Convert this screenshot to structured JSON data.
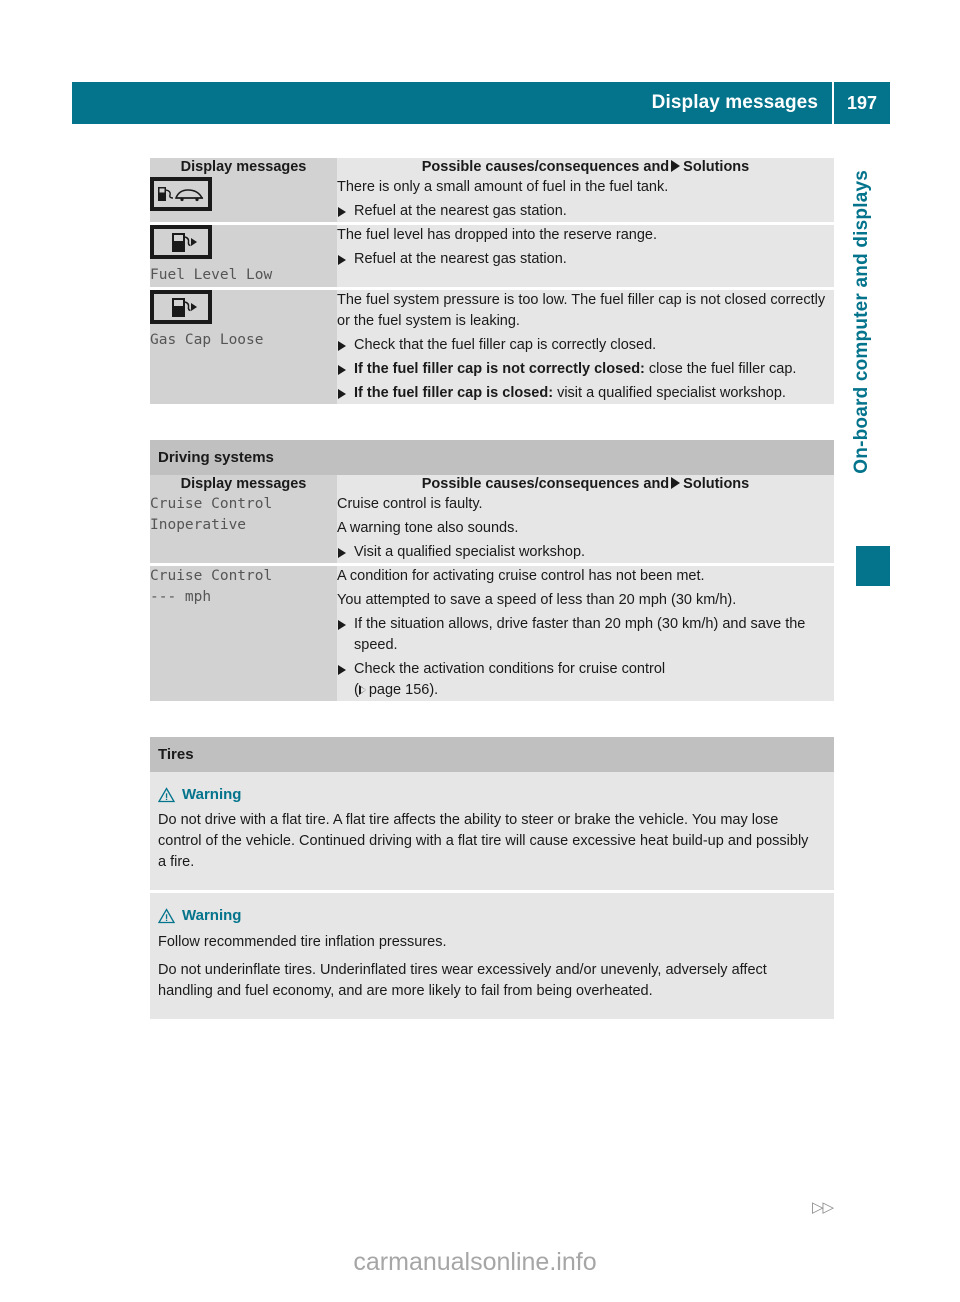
{
  "header": {
    "title": "Display messages",
    "page_number": "197"
  },
  "sidebar": {
    "chapter_label": "On-board computer and displays"
  },
  "table_fuel": {
    "col1_header": "Display messages",
    "col2_header_pre": "Possible causes/consequences and",
    "col2_header_post": "Solutions",
    "rows": [
      {
        "icon": "fuel-pump-car-icon",
        "message_code": "",
        "lines": [
          {
            "type": "para",
            "text": "There is only a small amount of fuel in the fuel tank."
          },
          {
            "type": "bullet",
            "text": "Refuel at the nearest gas station."
          }
        ]
      },
      {
        "icon": "fuel-pump-arrow-icon",
        "message_code": "Fuel Level Low",
        "lines": [
          {
            "type": "para",
            "text": "The fuel level has dropped into the reserve range."
          },
          {
            "type": "bullet",
            "text": "Refuel at the nearest gas station."
          }
        ]
      },
      {
        "icon": "fuel-pump-arrow-icon",
        "message_code": "Gas Cap Loose",
        "lines": [
          {
            "type": "para",
            "text": "The fuel system pressure is too low. The fuel filler cap is not closed correctly or the fuel system is leaking."
          },
          {
            "type": "bullet",
            "text": "Check that the fuel filler cap is correctly closed."
          },
          {
            "type": "bullet",
            "bold": "If the fuel filler cap is not correctly closed:",
            "text": "close the fuel filler cap."
          },
          {
            "type": "bullet",
            "bold": "If the fuel filler cap is closed:",
            "text": "visit a qualified specialist workshop."
          }
        ]
      }
    ]
  },
  "section_driving": {
    "band_title": "Driving systems",
    "col1_header": "Display messages",
    "col2_header_pre": "Possible causes/consequences and",
    "col2_header_post": "Solutions",
    "rows": [
      {
        "message_code": "Cruise Control\nInoperative",
        "lines": [
          {
            "type": "para",
            "text": "Cruise control is faulty."
          },
          {
            "type": "para",
            "text": "A warning tone also sounds."
          },
          {
            "type": "bullet",
            "text": "Visit a qualified specialist workshop."
          }
        ]
      },
      {
        "message_code": "Cruise Control\n--- mph",
        "lines": [
          {
            "type": "para",
            "text": "A condition for activating cruise control has not been met."
          },
          {
            "type": "para",
            "text": "You attempted to save a speed of less than 20 mph (30 km/h)."
          },
          {
            "type": "bullet",
            "text": "If the situation allows, drive faster than 20 mph (30 km/h) and save the speed."
          },
          {
            "type": "bullet-ref",
            "text": "Check the activation conditions for cruise control",
            "ref_open": "(",
            "ref_text": "page 156",
            "ref_close": ")."
          }
        ]
      }
    ]
  },
  "section_tires": {
    "band_title": "Tires",
    "warnings": [
      {
        "title": "Warning",
        "body": "Do not drive with a flat tire. A flat tire affects the ability to steer or brake the vehicle. You may lose control of the vehicle. Continued driving with a flat tire will cause excessive heat build-up and possibly a fire."
      },
      {
        "title": "Warning",
        "body_1": "Follow recommended tire inflation pressures.",
        "body_2": "Do not underinflate tires. Underinflated tires wear excessively and/or unevenly, adversely affect handling and fuel economy, and are more likely to fail from being overheated."
      }
    ]
  },
  "footer": {
    "continuation_marker": "▷▷",
    "watermark": "carmanualsonline.info"
  },
  "colors": {
    "accent_teal": "#03748c",
    "col1_gray": "#d2d2d2",
    "col2_gray": "#e6e6e6",
    "band_gray": "#c0c0c0"
  }
}
